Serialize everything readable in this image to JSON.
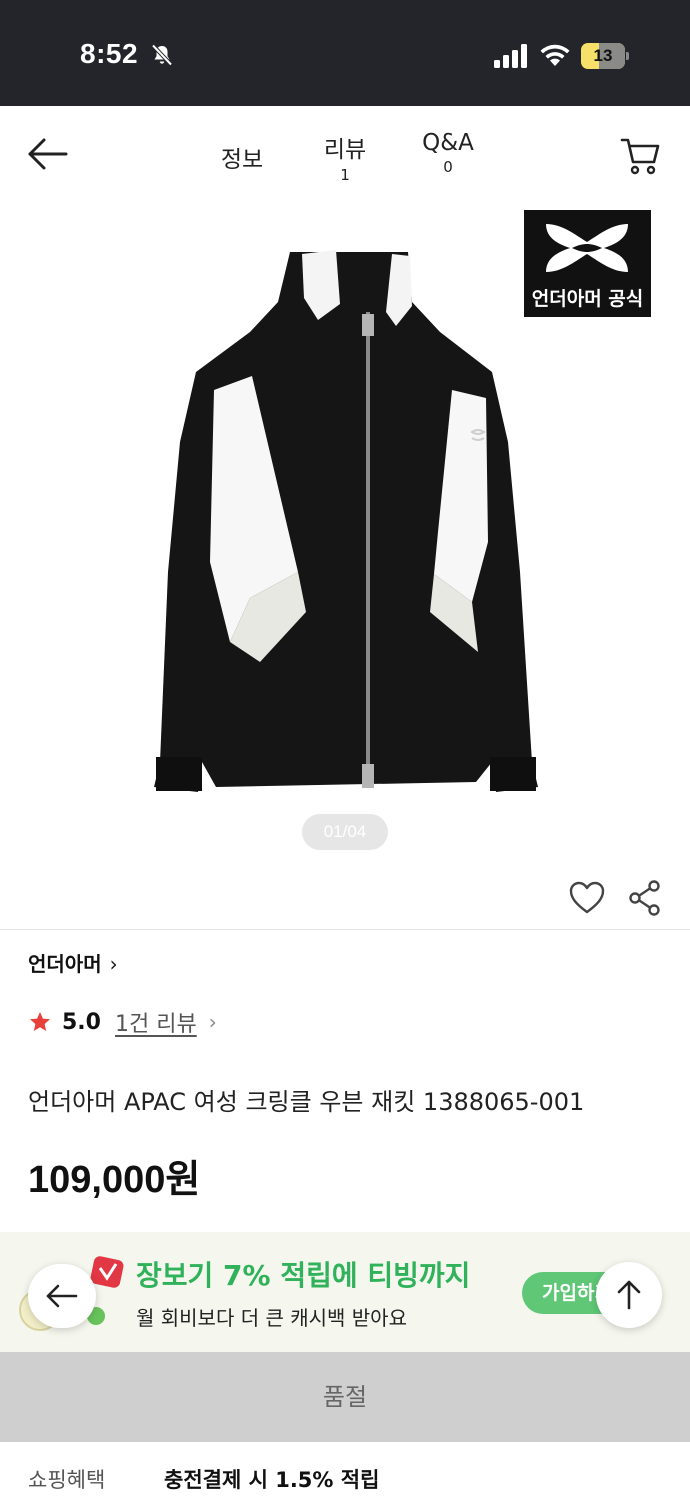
{
  "status_bar": {
    "time": "8:52",
    "battery": "13"
  },
  "nav": {
    "tabs": [
      {
        "label": "정보",
        "count": ""
      },
      {
        "label": "리뷰",
        "count": "1"
      },
      {
        "label": "Q&A",
        "count": "0"
      }
    ]
  },
  "gallery": {
    "counter": "01/04",
    "badge_text": "언더아머 공식"
  },
  "product": {
    "brand": "언더아머",
    "rating": "5.0",
    "review_link": "1건 리뷰",
    "title": "언더아머 APAC 여성 크링클 우븐 재킷 1388065-001",
    "price": "109,000원"
  },
  "promo": {
    "title": "장보기 7% 적립에 티빙까지",
    "subtitle": "월 회비보다 더 큰 캐시백 받아요",
    "join_label": "가입하기"
  },
  "soldout_label": "품절",
  "benefit": {
    "label": "쇼핑혜택",
    "value": "충전결제 시 1.5% 적립"
  },
  "colors": {
    "accent_green": "#2fb25a",
    "star_red": "#e8413c",
    "status_bar_bg": "#24252a"
  }
}
